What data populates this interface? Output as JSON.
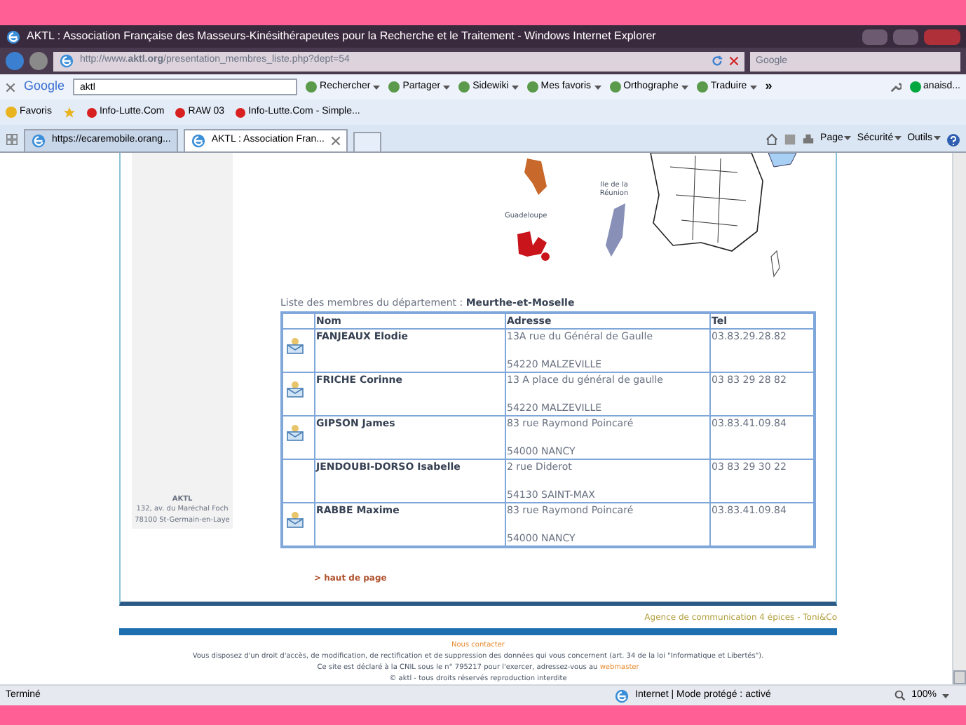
{
  "window": {
    "title": "AKTL : Association Française des Masseurs-Kinésithérapeutes pour la Recherche et le Traitement  - Windows Internet Explorer"
  },
  "address_bar": {
    "url": "http://www.**aktl.org**/presentation_membres_liste.php?dept=54",
    "search_placeholder": "Google"
  },
  "google_toolbar": {
    "brand": "Google",
    "query": "aktl",
    "items": [
      {
        "label": "Rechercher"
      },
      {
        "label": "Partager"
      },
      {
        "label": "Sidewiki"
      },
      {
        "label": "Mes favoris"
      },
      {
        "label": "Orthographe"
      },
      {
        "label": "Traduire"
      }
    ],
    "more": "»",
    "account": "anaisd..."
  },
  "favorites_bar": {
    "label": "Favoris",
    "items": [
      "Info-Lutte.Com",
      "RAW 03",
      "Info-Lutte.Com - Simple..."
    ]
  },
  "tabs": [
    {
      "label": "https://ecaremobile.orang...",
      "selected": false
    },
    {
      "label": "AKTL : Association Fran...",
      "selected": true
    }
  ],
  "command_bar": [
    "Page",
    "Sécurité",
    "Outils"
  ],
  "map": {
    "labels": [
      "Ile de la Réunion",
      "Guadeloupe"
    ]
  },
  "sidebar": {
    "name": "AKTL",
    "address_lines": [
      "132, av. du Maréchal Foch",
      "78100 St-Germain-en-Laye"
    ]
  },
  "members": {
    "caption": "Liste des membres du département : ",
    "department": "Meurthe-et-Moselle",
    "columns": [
      "Nom",
      "Adresse",
      "Tel"
    ],
    "rows": [
      {
        "mail_icon": true,
        "name": "FANJEAUX Elodie",
        "street": "13A rue du Général de Gaulle",
        "city": "54220 MALZEVILLE",
        "tel": "03.83.29.28.82"
      },
      {
        "mail_icon": true,
        "name": "FRICHE Corinne",
        "street": "13 A place du général de gaulle",
        "city": "54220 MALZEVILLE",
        "tel": "03 83 29 28 82"
      },
      {
        "mail_icon": true,
        "name": "GIPSON James",
        "street": "83 rue Raymond Poincaré",
        "city": "54000 NANCY",
        "tel": "03.83.41.09.84"
      },
      {
        "mail_icon": false,
        "name": "JENDOUBI-DORSO Isabelle",
        "street": "2 rue Diderot",
        "city": "54130 SAINT-MAX",
        "tel": "03 83 29 30 22"
      },
      {
        "mail_icon": true,
        "name": "RABBE Maxime",
        "street": "83 rue Raymond Poincaré",
        "city": "54000 NANCY",
        "tel": "03.83.41.09.84"
      }
    ]
  },
  "top_link": "> haut de page",
  "agency": "Agence de communication 4 épices - Toni&Co",
  "footer": {
    "contact": "Nous contacter",
    "rights": "Vous disposez d'un droit d'accès, de modification, de rectification et de suppression des données qui vous concernent (art. 34 de la loi \"Informatique et Libertés\").",
    "cnil": "Ce site est déclaré à la CNIL sous le n° 795217 pour l'exercer, adressez-vous au ",
    "webmaster": "webmaster",
    "copyright": "© aktl - tous droits réservés reproduction interdite"
  },
  "status_bar": {
    "text": "Terminé",
    "zone": "Internet | Mode protégé : activé",
    "zoom": "100%"
  }
}
